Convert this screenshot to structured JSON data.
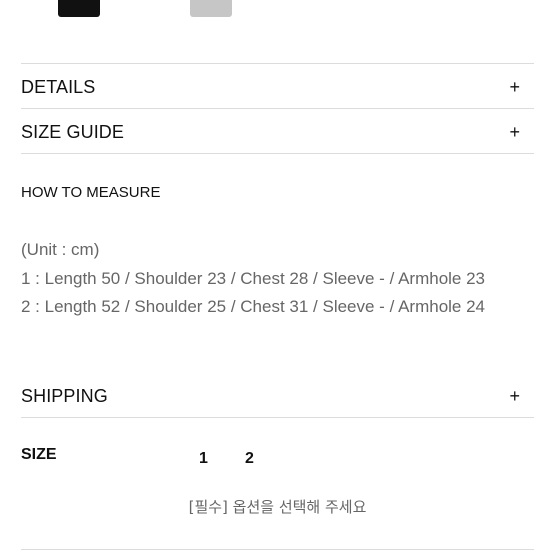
{
  "product": {
    "swatch_colors": [
      "#111111",
      "#c6c6c6"
    ]
  },
  "accordion": {
    "details_label": "DETAILS",
    "size_guide_label": "SIZE GUIDE",
    "shipping_label": "SHIPPING",
    "expand_glyph": "+"
  },
  "size_guide": {
    "measure_title": "HOW TO MEASURE",
    "unit": "(Unit : cm)",
    "rows": [
      "1 : Length 50 / Shoulder 23 / Chest 28 / Sleeve - / Armhole 23",
      "2 : Length 52 / Shoulder 25 / Chest 31 / Sleeve - / Armhole 24"
    ]
  },
  "size_selector": {
    "label": "SIZE",
    "options": [
      "1",
      "2"
    ],
    "notice": "[필수] 옵션을 선택해 주세요"
  }
}
